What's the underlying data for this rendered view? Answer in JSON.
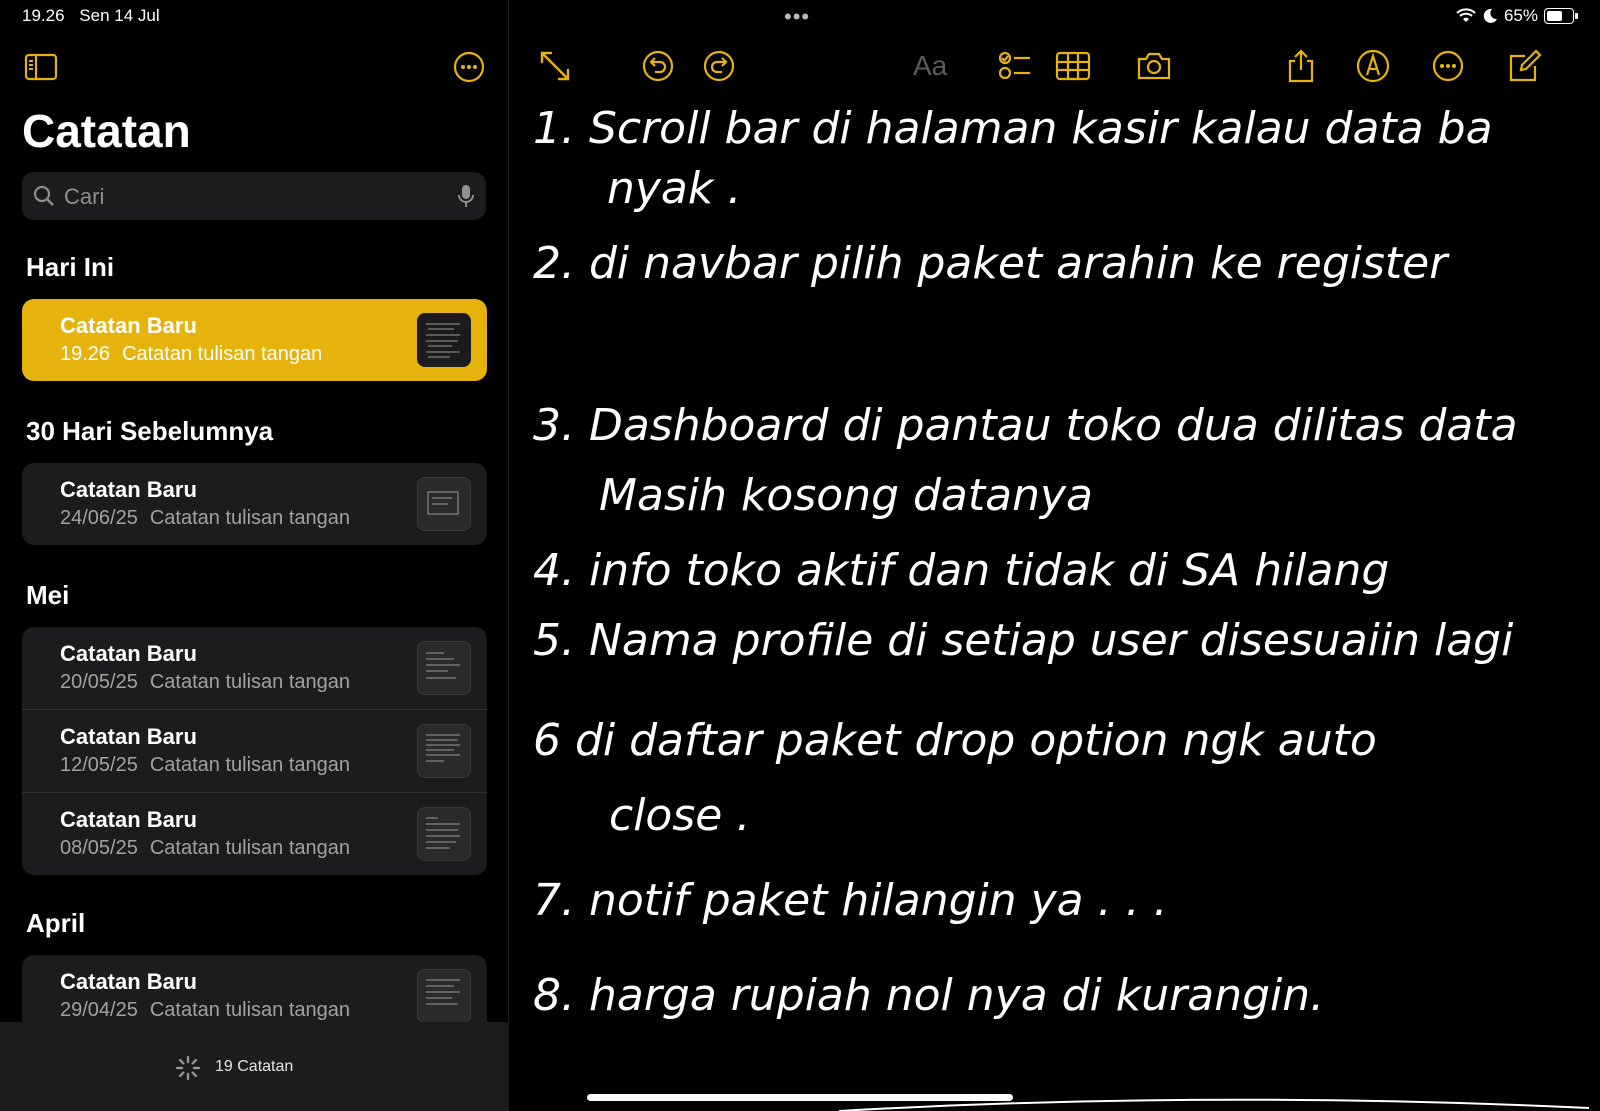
{
  "status": {
    "time": "19.26",
    "date": "Sen 14 Jul",
    "battery": "65%",
    "battery_level": 0.65
  },
  "sidebar": {
    "title": "Catatan",
    "search_placeholder": "Cari",
    "sections": [
      {
        "label": "Hari Ini",
        "notes": [
          {
            "title": "Catatan Baru",
            "date": "19.26",
            "subtitle": "Catatan tulisan tangan",
            "selected": true
          }
        ]
      },
      {
        "label": "30 Hari Sebelumnya",
        "notes": [
          {
            "title": "Catatan Baru",
            "date": "24/06/25",
            "subtitle": "Catatan tulisan tangan"
          }
        ]
      },
      {
        "label": "Mei",
        "notes": [
          {
            "title": "Catatan Baru",
            "date": "20/05/25",
            "subtitle": "Catatan tulisan tangan"
          },
          {
            "title": "Catatan Baru",
            "date": "12/05/25",
            "subtitle": "Catatan tulisan tangan"
          },
          {
            "title": "Catatan Baru",
            "date": "08/05/25",
            "subtitle": "Catatan tulisan tangan"
          }
        ]
      },
      {
        "label": "April",
        "notes": [
          {
            "title": "Catatan Baru",
            "date": "29/04/25",
            "subtitle": "Catatan tulisan tangan"
          }
        ]
      }
    ],
    "footer_count": "19 Catatan"
  },
  "toolbar": {
    "format_label": "Aa"
  },
  "note": {
    "lines": [
      "1. Scroll bar di halaman kasir kalau data ba",
      "nyak .",
      "2. di navbar pilih paket arahin ke register",
      "3. Dashboard di pantau toko dua dilitas data",
      "Masih kosong datanya",
      "4. info toko aktif dan tidak di SA hilang",
      "5. Nama profile di setiap user disesuaiin lagi",
      "6 di daftar paket drop option ngk auto",
      "close .",
      "7. notif paket hilangin ya . . .",
      "8. harga rupiah nol nya di kurangin."
    ]
  },
  "colors": {
    "accent": "#e6b30c",
    "background": "#000000",
    "panel": "#1c1c1e"
  }
}
